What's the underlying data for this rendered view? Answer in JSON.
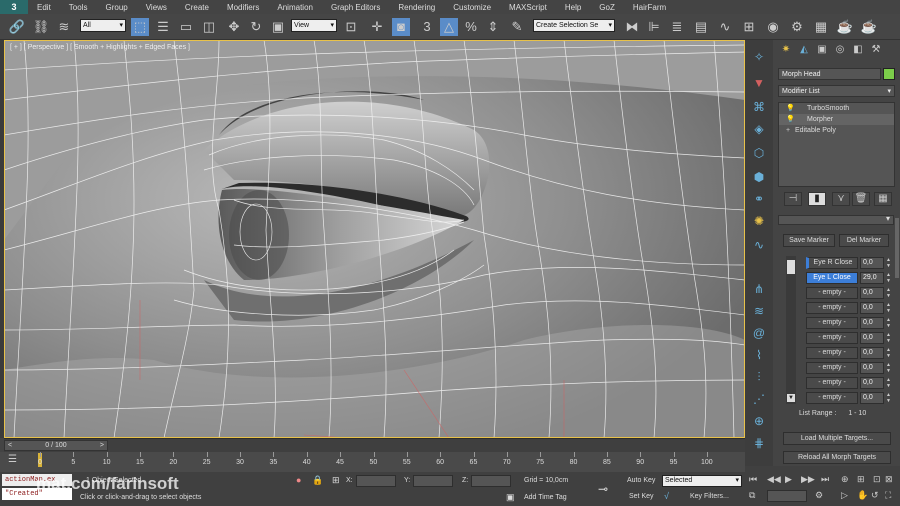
{
  "menubar": {
    "items": [
      "Edit",
      "Tools",
      "Group",
      "Views",
      "Create",
      "Modifiers",
      "Animation",
      "Graph Editors",
      "Rendering",
      "Customize",
      "MAXScript",
      "Help",
      "GoZ",
      "HairFarm"
    ]
  },
  "toolbar": {
    "filter_value": "All",
    "refcoord_value": "View",
    "selection_set_placeholder": "Create Selection Se"
  },
  "viewport": {
    "label": "[ + ] [ Perspective ] [ Smooth + Highlights + Edged Faces ]"
  },
  "command_panel": {
    "object_name": "Morph Head",
    "object_color": "#7ccd4a",
    "modifier_list_label": "Modifier List",
    "stack": [
      {
        "label": "TurboSmooth",
        "selected": false
      },
      {
        "label": "Morpher",
        "selected": true
      },
      {
        "label": "Editable Poly",
        "selected": false
      }
    ],
    "save_marker_label": "Save Marker",
    "del_marker_label": "Del Marker",
    "channels": [
      {
        "name": "Eye R Close",
        "value": "0,0"
      },
      {
        "name": "Eye L Close",
        "value": "29,0"
      },
      {
        "name": "- empty -",
        "value": "0,0"
      },
      {
        "name": "- empty -",
        "value": "0,0"
      },
      {
        "name": "- empty -",
        "value": "0,0"
      },
      {
        "name": "- empty -",
        "value": "0,0"
      },
      {
        "name": "- empty -",
        "value": "0,0"
      },
      {
        "name": "- empty -",
        "value": "0,0"
      },
      {
        "name": "- empty -",
        "value": "0,0"
      },
      {
        "name": "- empty -",
        "value": "0,0"
      }
    ],
    "list_range_label": "List Range :",
    "list_range_value": "1 - 10",
    "load_targets_label": "Load Multiple Targets...",
    "reload_targets_label": "Reload All Morph Targets"
  },
  "timeline": {
    "slider_label": "0 / 100",
    "ticks": [
      "0",
      "5",
      "10",
      "15",
      "20",
      "25",
      "30",
      "35",
      "40",
      "45",
      "50",
      "55",
      "60",
      "65",
      "70",
      "75",
      "80",
      "85",
      "90",
      "95",
      "100"
    ]
  },
  "status": {
    "maxscript_line1": "actionMan.ex",
    "maxscript_line2": "\"Created\"",
    "selected_text": "1 Object Selected",
    "prompt_text": "Click or click-and-drag to select objects",
    "x_label": "X:",
    "y_label": "Y:",
    "z_label": "Z:",
    "grid_text": "Grid = 10,0cm",
    "add_time_tag": "Add Time Tag",
    "auto_key_label": "Auto Key",
    "auto_key_value": "Selected",
    "set_key_label": "Set Key",
    "key_filters_label": "Key Filters...",
    "watermark": "mat.com/farinsoft"
  }
}
